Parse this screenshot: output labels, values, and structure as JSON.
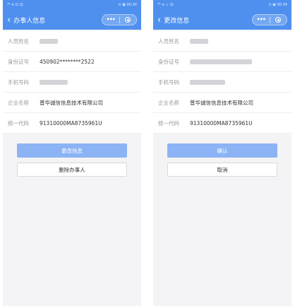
{
  "left": {
    "status_bar": {
      "left": "⁴ᴳ ≋ ⊡ ☺",
      "right": "⊙ ▣ 00:34"
    },
    "title": "办事人信息",
    "fields": [
      {
        "label": "人员姓名",
        "value": ""
      },
      {
        "label": "身份证号",
        "value": "450902********2522"
      },
      {
        "label": "手机号码",
        "value": ""
      },
      {
        "label": "企业名称",
        "value": "普华诚信信息技术有限公司"
      },
      {
        "label": "统一代码",
        "value": "91310000MA8735961U"
      }
    ],
    "primary_button": "更改信息",
    "secondary_button": "删除办事人"
  },
  "right": {
    "status_bar": {
      "left": "⁴ᴳ ≋ ⊥ ☺",
      "right": "⊙ ▣ 00:34"
    },
    "title": "更改信息",
    "fields": [
      {
        "label": "人员姓名",
        "value": ""
      },
      {
        "label": "身份证号",
        "value": ""
      },
      {
        "label": "手机号码",
        "value": ""
      },
      {
        "label": "企业名称",
        "value": "普华诚信信息技术有限公司"
      },
      {
        "label": "统一代码",
        "value": "91310000MA8735961U"
      }
    ],
    "primary_button": "确认",
    "secondary_button": "取消"
  },
  "colors": {
    "header": "#4f90ef",
    "primary_button": "#8cb3f4",
    "background": "#f4f4f6"
  },
  "icons": [
    "back-chevron-icon",
    "more-icon",
    "target-icon"
  ]
}
